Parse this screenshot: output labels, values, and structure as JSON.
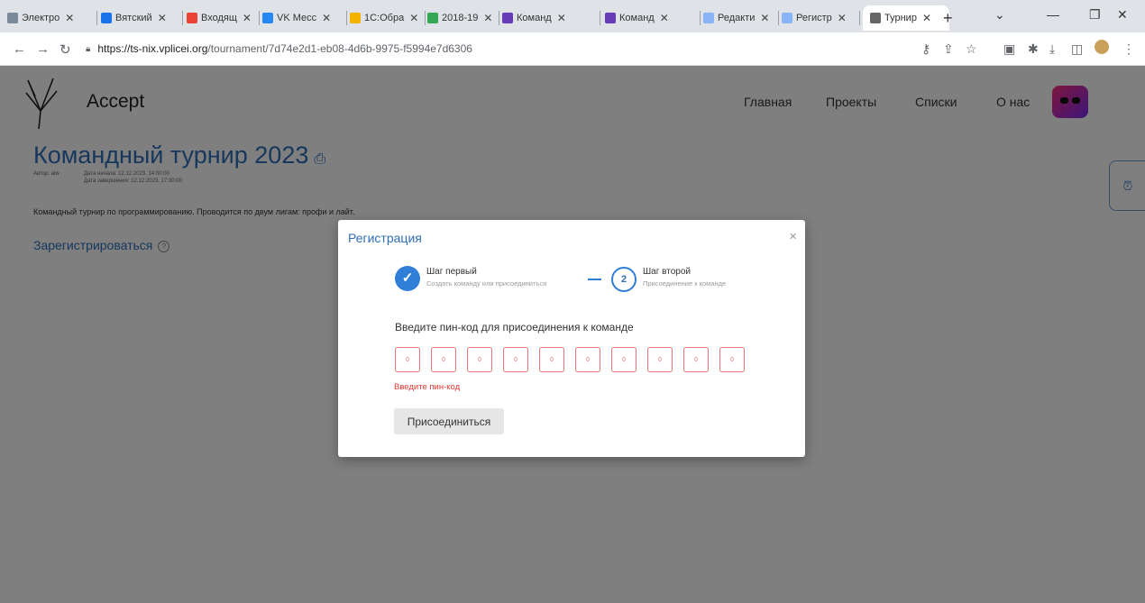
{
  "browser": {
    "tabs": [
      {
        "label": "Электро",
        "color": "#7a8a99"
      },
      {
        "label": "Вятский",
        "color": "#1a73e8"
      },
      {
        "label": "Входящ",
        "color": "#ea4335"
      },
      {
        "label": "VK Месс",
        "color": "#2787f5"
      },
      {
        "label": "1С:Обра",
        "color": "#f4b400"
      },
      {
        "label": "2018-19",
        "color": "#34a853"
      },
      {
        "label": "Команд",
        "color": "#673ab7"
      },
      {
        "label": "Команд",
        "color": "#673ab7"
      },
      {
        "label": "Редакти",
        "color": "#8ab4f8"
      },
      {
        "label": "Регистр",
        "color": "#8ab4f8"
      },
      {
        "label": "Турнир",
        "color": "#666666"
      }
    ],
    "url_host": "https://ts-nix.vplicei.org",
    "url_path": "/tournament/7d74e2d1-eb08-4d6b-9975-f5994e7d6306"
  },
  "site": {
    "brand": "Accept",
    "menu": [
      "Главная",
      "Проекты",
      "Списки",
      "О нас"
    ]
  },
  "tournament": {
    "title": "Командный турнир 2023",
    "author": "Автор: aiw",
    "start": "Дата начала: 12.12.2023, 14:00:00",
    "end": "Дата завершения: 12.12.2023, 17:30:00",
    "description": "Командный турнир по программированию. Проводится по двум лигам: профи и лайт.",
    "register": "Зарегистрироваться"
  },
  "modal": {
    "title": "Регистрация",
    "step1_title": "Шаг первый",
    "step1_sub": "Создать команду или присоединиться",
    "step2_number": "2",
    "step2_title": "Шаг второй",
    "step2_sub": "Присоединение к команде",
    "prompt": "Введите пин-код для присоединения к команде",
    "pin_placeholder": "0",
    "pin_count": 10,
    "error": "Введите пин-код",
    "join_button": "Присоединиться"
  },
  "colors": {
    "accent": "#2f6fb8",
    "error": "#e53935"
  }
}
